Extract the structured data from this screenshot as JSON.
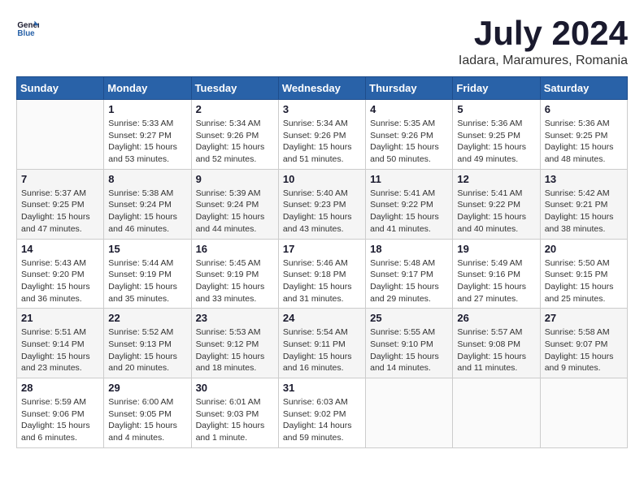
{
  "header": {
    "logo_line1": "General",
    "logo_line2": "Blue",
    "month_year": "July 2024",
    "location": "Iadara, Maramures, Romania"
  },
  "weekdays": [
    "Sunday",
    "Monday",
    "Tuesday",
    "Wednesday",
    "Thursday",
    "Friday",
    "Saturday"
  ],
  "weeks": [
    [
      {
        "day": "",
        "info": ""
      },
      {
        "day": "1",
        "info": "Sunrise: 5:33 AM\nSunset: 9:27 PM\nDaylight: 15 hours\nand 53 minutes."
      },
      {
        "day": "2",
        "info": "Sunrise: 5:34 AM\nSunset: 9:26 PM\nDaylight: 15 hours\nand 52 minutes."
      },
      {
        "day": "3",
        "info": "Sunrise: 5:34 AM\nSunset: 9:26 PM\nDaylight: 15 hours\nand 51 minutes."
      },
      {
        "day": "4",
        "info": "Sunrise: 5:35 AM\nSunset: 9:26 PM\nDaylight: 15 hours\nand 50 minutes."
      },
      {
        "day": "5",
        "info": "Sunrise: 5:36 AM\nSunset: 9:25 PM\nDaylight: 15 hours\nand 49 minutes."
      },
      {
        "day": "6",
        "info": "Sunrise: 5:36 AM\nSunset: 9:25 PM\nDaylight: 15 hours\nand 48 minutes."
      }
    ],
    [
      {
        "day": "7",
        "info": "Sunrise: 5:37 AM\nSunset: 9:25 PM\nDaylight: 15 hours\nand 47 minutes."
      },
      {
        "day": "8",
        "info": "Sunrise: 5:38 AM\nSunset: 9:24 PM\nDaylight: 15 hours\nand 46 minutes."
      },
      {
        "day": "9",
        "info": "Sunrise: 5:39 AM\nSunset: 9:24 PM\nDaylight: 15 hours\nand 44 minutes."
      },
      {
        "day": "10",
        "info": "Sunrise: 5:40 AM\nSunset: 9:23 PM\nDaylight: 15 hours\nand 43 minutes."
      },
      {
        "day": "11",
        "info": "Sunrise: 5:41 AM\nSunset: 9:22 PM\nDaylight: 15 hours\nand 41 minutes."
      },
      {
        "day": "12",
        "info": "Sunrise: 5:41 AM\nSunset: 9:22 PM\nDaylight: 15 hours\nand 40 minutes."
      },
      {
        "day": "13",
        "info": "Sunrise: 5:42 AM\nSunset: 9:21 PM\nDaylight: 15 hours\nand 38 minutes."
      }
    ],
    [
      {
        "day": "14",
        "info": "Sunrise: 5:43 AM\nSunset: 9:20 PM\nDaylight: 15 hours\nand 36 minutes."
      },
      {
        "day": "15",
        "info": "Sunrise: 5:44 AM\nSunset: 9:19 PM\nDaylight: 15 hours\nand 35 minutes."
      },
      {
        "day": "16",
        "info": "Sunrise: 5:45 AM\nSunset: 9:19 PM\nDaylight: 15 hours\nand 33 minutes."
      },
      {
        "day": "17",
        "info": "Sunrise: 5:46 AM\nSunset: 9:18 PM\nDaylight: 15 hours\nand 31 minutes."
      },
      {
        "day": "18",
        "info": "Sunrise: 5:48 AM\nSunset: 9:17 PM\nDaylight: 15 hours\nand 29 minutes."
      },
      {
        "day": "19",
        "info": "Sunrise: 5:49 AM\nSunset: 9:16 PM\nDaylight: 15 hours\nand 27 minutes."
      },
      {
        "day": "20",
        "info": "Sunrise: 5:50 AM\nSunset: 9:15 PM\nDaylight: 15 hours\nand 25 minutes."
      }
    ],
    [
      {
        "day": "21",
        "info": "Sunrise: 5:51 AM\nSunset: 9:14 PM\nDaylight: 15 hours\nand 23 minutes."
      },
      {
        "day": "22",
        "info": "Sunrise: 5:52 AM\nSunset: 9:13 PM\nDaylight: 15 hours\nand 20 minutes."
      },
      {
        "day": "23",
        "info": "Sunrise: 5:53 AM\nSunset: 9:12 PM\nDaylight: 15 hours\nand 18 minutes."
      },
      {
        "day": "24",
        "info": "Sunrise: 5:54 AM\nSunset: 9:11 PM\nDaylight: 15 hours\nand 16 minutes."
      },
      {
        "day": "25",
        "info": "Sunrise: 5:55 AM\nSunset: 9:10 PM\nDaylight: 15 hours\nand 14 minutes."
      },
      {
        "day": "26",
        "info": "Sunrise: 5:57 AM\nSunset: 9:08 PM\nDaylight: 15 hours\nand 11 minutes."
      },
      {
        "day": "27",
        "info": "Sunrise: 5:58 AM\nSunset: 9:07 PM\nDaylight: 15 hours\nand 9 minutes."
      }
    ],
    [
      {
        "day": "28",
        "info": "Sunrise: 5:59 AM\nSunset: 9:06 PM\nDaylight: 15 hours\nand 6 minutes."
      },
      {
        "day": "29",
        "info": "Sunrise: 6:00 AM\nSunset: 9:05 PM\nDaylight: 15 hours\nand 4 minutes."
      },
      {
        "day": "30",
        "info": "Sunrise: 6:01 AM\nSunset: 9:03 PM\nDaylight: 15 hours\nand 1 minute."
      },
      {
        "day": "31",
        "info": "Sunrise: 6:03 AM\nSunset: 9:02 PM\nDaylight: 14 hours\nand 59 minutes."
      },
      {
        "day": "",
        "info": ""
      },
      {
        "day": "",
        "info": ""
      },
      {
        "day": "",
        "info": ""
      }
    ]
  ]
}
